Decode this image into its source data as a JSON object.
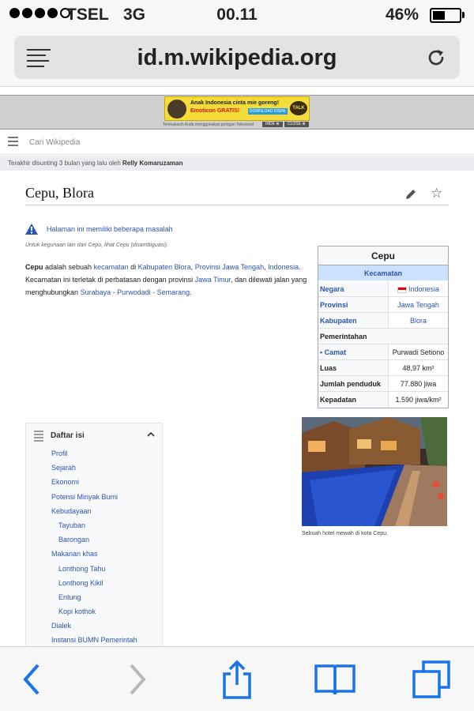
{
  "status_bar": {
    "carrier": "TSEL",
    "network": "3G",
    "time": "00.11",
    "battery_pct": "46%",
    "battery_level": 0.46,
    "signal_bars": 4
  },
  "browser": {
    "url": "id.m.wikipedia.org"
  },
  "ad": {
    "line1": "Anak Indonesia cinta mie goreng!",
    "line2": "Emoticon GRATIS!",
    "download": "DOWNLOAD DISINI",
    "talk": "TALK",
    "footer": "Terimakasih Anda menggunakan jaringan Telkomsel",
    "btn_inde": "INDE ⊗",
    "btn_close": "CLOSE ⊗"
  },
  "wiki": {
    "search_placeholder": "Cari Wikipedia",
    "last_edit_prefix": "Terakhir disunting 3 bulan yang lalu oleh",
    "last_edit_user": "Relly Komaruzaman"
  },
  "article": {
    "title": "Cepu, Blora",
    "issues": "Halaman ini memiliki beberapa masalah",
    "hatnote": "Untuk kegunaan lain dari Cepu, lihat Cepu (disambiguasi).",
    "intro": {
      "t1": "Cepu",
      "t2": " adalah sebuah ",
      "l1": "kecamatan",
      "t3": " di ",
      "l2": "Kabupaten Blora",
      "t4": ", ",
      "l3": "Provinsi Jawa Tengah",
      "t5": ", ",
      "l4": "Indonesia",
      "t6": ". Kecamatan ini terletak di perbatasan dengan provinsi ",
      "l5": "Jawa Timur",
      "t7": ", dan dilewati jalan yang menghubungkan ",
      "l6": "Surabaya - Purwodadi - Semarang",
      "t8": "."
    }
  },
  "infobox": {
    "title": "Cepu",
    "subtitle": "Kecamatan",
    "rows": [
      {
        "key": "Negara",
        "value": "Indonesia"
      },
      {
        "key": "Provinsi",
        "value": "Jawa Tengah"
      },
      {
        "key": "Kabupaten",
        "value": "Blora"
      },
      {
        "key": "Pemerintahan",
        "value": ""
      },
      {
        "key": "• Camat",
        "value": "Purwadi Setiono"
      },
      {
        "key": "Luas",
        "value": "48,97 km²"
      },
      {
        "key": "Jumlah penduduk",
        "value": "77.880 jiwa"
      },
      {
        "key": "Kepadatan",
        "value": "1.590 jiwa/km²"
      }
    ]
  },
  "toc": {
    "title": "Daftar isi",
    "items": [
      "Profil",
      "Sejarah",
      "Ekonomi",
      "Potensi Minyak Bumi",
      "Kebudayaan",
      "Tayuban",
      "Barongan",
      "Makanan khas",
      "Lonthong Tahu",
      "Lonthong Kikil",
      "Entung",
      "Kopi kothok",
      "Dialek",
      "Instansi BUMN Pemerintah"
    ]
  },
  "image": {
    "caption": "Sebuah hotel mewah di kota Cepu."
  },
  "colors": {
    "link": "#2a55b0",
    "ios_blue": "#1a73e8",
    "infobox_sub": "#cce0ff",
    "ad_yellow": "#f4dc3a"
  }
}
